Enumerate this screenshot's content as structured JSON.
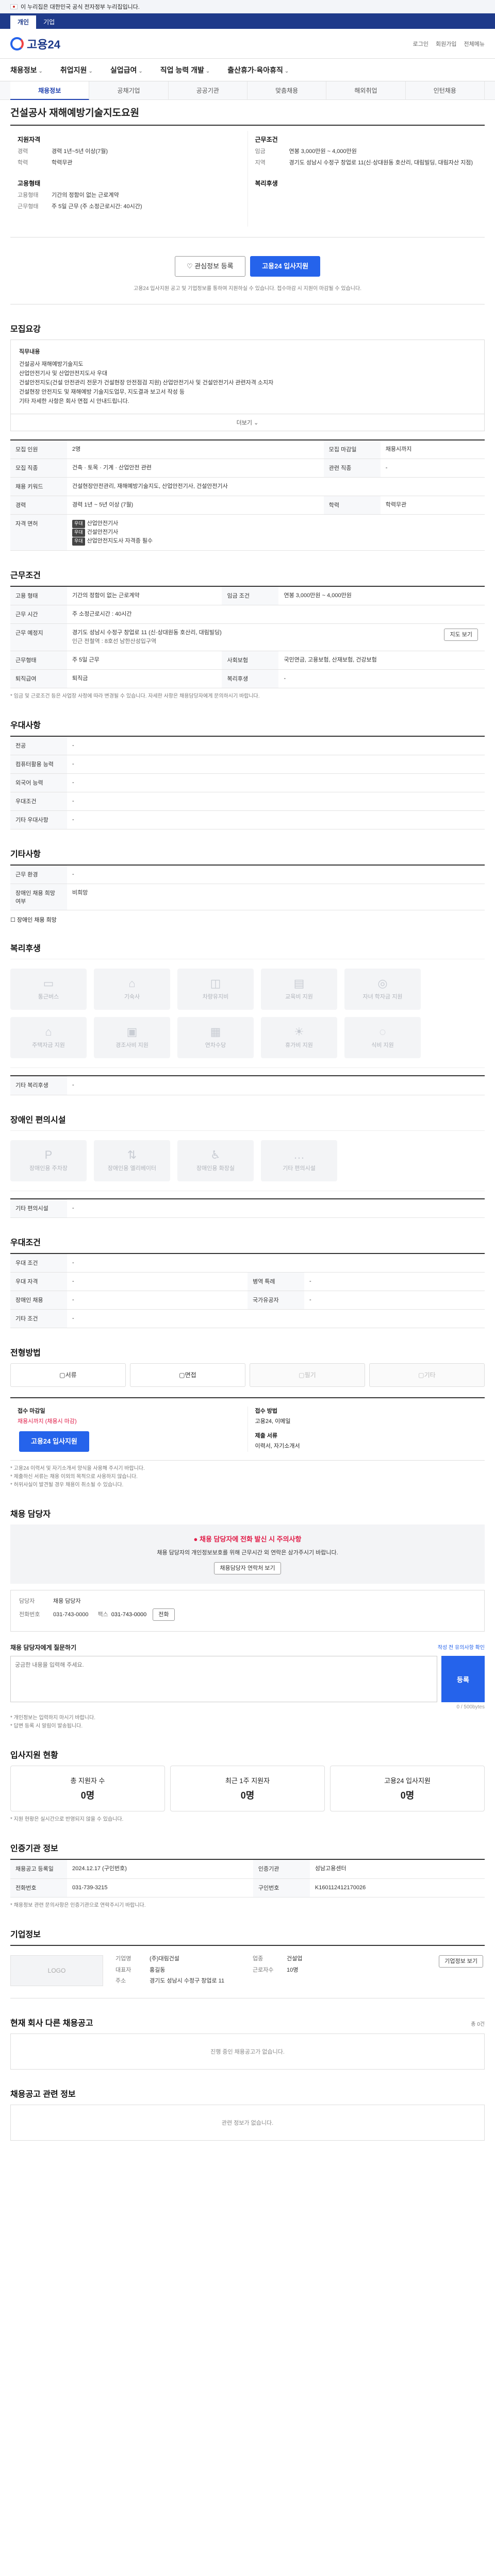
{
  "gov_banner": "이 누리집은 대한민국 공식 전자정부 누리집입니다.",
  "top_tabs": [
    "개인",
    "기업"
  ],
  "logo_text": "고용24",
  "util_links": [
    "로그인",
    "회원가입",
    "전체메뉴"
  ],
  "gnb": [
    {
      "label": "채용정보",
      "caret": "⌄"
    },
    {
      "label": "취업지원",
      "caret": "⌄"
    },
    {
      "label": "실업급여",
      "caret": "⌄"
    },
    {
      "label": "직업 능력 개발",
      "caret": "⌄"
    },
    {
      "label": "출산휴가·육아휴직",
      "caret": "⌄"
    }
  ],
  "sub_tabs": [
    "채용정보",
    "공채기업",
    "공공기관",
    "맞춤채용",
    "해외취업",
    "인턴채용"
  ],
  "page_title": "건설공사 재해예방기술지도요원",
  "summary": {
    "col1": {
      "h": "지원자격",
      "rows": [
        [
          "경력",
          "경력 1년~5년 이상(7월)"
        ],
        [
          "학력",
          "학력무관"
        ]
      ]
    },
    "col2": {
      "h": "근무조건",
      "rows": [
        [
          "임금",
          "연봉 3,000만원 ~ 4,000만원"
        ],
        [
          "지역",
          "경기도 성남시 수정구 창업로 11(신·상대원동 호산리, 대림빌딩, 대림자산 지점)"
        ]
      ]
    },
    "col3": {
      "h": "고용형태",
      "rows": [
        [
          "고용형태",
          "기간의 정함이 없는 근로계약"
        ],
        [
          "근무형태",
          "주 5일 근무 (주 소정근로시간: 40시간)"
        ]
      ]
    },
    "col4": {
      "h": "복리후생",
      "rows": []
    }
  },
  "actions": {
    "save": "관심정보 등록",
    "apply": "고용24 입사지원"
  },
  "actions_note": "고용24 입사지원 공고 및 기업정보를 통하여 지원하실 수 있습니다. 접수마감 시 지원이 마감될 수 있습니다.",
  "recruit": {
    "h": "모집요강",
    "box_title": "직무내용",
    "lines": [
      "건설공사 재해예방기술지도",
      "산업안전기사 및 산업안전지도사 우대",
      "건설안전지도(건설 안전관리 전문가 건설현장 안전점검 지원) 산업안전기사 및 건설안전기사 관련자격 소지자",
      "건설현장 안전지도 및 재해예방 기술지도업무, 지도결과 보고서 작성 등",
      "기타 자세한 사항은 회사 면접 시 안내드립니다."
    ],
    "more": "더보기",
    "table": [
      [
        "모집 인원",
        "2명",
        "모집 마감일",
        "채용시까지"
      ],
      [
        "모집 직종",
        "건축 · 토목 · 기계 · 산업안전 관련",
        "관련 직종",
        "-"
      ],
      [
        "채용 키워드",
        "건설현장안전관리, 재해예방기술지도, 산업안전기사, 건설안전기사",
        "",
        ""
      ],
      [
        "경력",
        "경력 1년 ~ 5년 이상 (7월)",
        "학력",
        "학력무관"
      ]
    ],
    "cert_label": "자격 면허",
    "certs": [
      {
        "badge": "우대",
        "text": "산업안전기사"
      },
      {
        "badge": "우대",
        "text": "건설안전기사"
      },
      {
        "badge": "우대",
        "text": "산업안전지도사 자격증 필수"
      }
    ]
  },
  "conditions": {
    "h": "근무조건",
    "rows": [
      [
        "고용 형태",
        "기간의 정함이 없는 근로계약",
        "임금 조건",
        "연봉 3,000만원 ~ 4,000만원"
      ],
      [
        "근무 시간",
        "주 소정근로시간 : 40시간",
        "",
        ""
      ],
      [
        "근무 예정지",
        "경기도 성남시 수정구 창업로 11 (신·상대원동 호산리, 대림빌딩)",
        "",
        ""
      ],
      [
        "근무형태",
        "주 5일 근무",
        "사회보험",
        "국민연금, 고용보험, 산재보험, 건강보험"
      ],
      [
        "퇴직급여",
        "퇴직금",
        "복리후생",
        "-"
      ]
    ],
    "view_map": "지도 보기",
    "subway": "인근 전철역 : 8호선 남한산성입구역",
    "footnote": "* 임금 및 근로조건 등은 사업장 사정에 따라 변경될 수 있습니다. 자세한 사항은 채용담당자에게 문의하시기 바랍니다."
  },
  "prefer": {
    "h": "우대사항",
    "rows": [
      [
        "전공",
        "-"
      ],
      [
        "컴퓨터활용 능력",
        "-"
      ],
      [
        "외국어 능력",
        "-"
      ],
      [
        "우대조건",
        "-"
      ],
      [
        "기타 우대사항",
        "-"
      ]
    ]
  },
  "prefer_other": {
    "h": "기타사항",
    "rows": [
      [
        "근무 환경",
        "-"
      ],
      [
        "장애인 채용 희망 여부",
        "비희망"
      ]
    ],
    "checkbox": "장애인 채용 희망"
  },
  "welfare": {
    "h": "복리후생",
    "items": [
      "통근버스",
      "기숙사",
      "차량유지비",
      "교육비 지원",
      "자녀 학자금 지원",
      "주택자금 지원",
      "경조사비 지원",
      "연차수당",
      "휴가비 지원",
      "식비 지원"
    ],
    "other_label": "기타 복리후생",
    "other_value": "-"
  },
  "disabled": {
    "h": "장애인 편의시설",
    "items": [
      "장애인용 주차장",
      "장애인용 엘리베이터",
      "장애인용 화장실",
      "기타 편의시설"
    ],
    "other_label": "기타 편의시설",
    "other_value": "-"
  },
  "selection": {
    "h": "우대조건",
    "rows": [
      [
        "우대 조건",
        "-",
        "",
        ""
      ],
      [
        "우대 자격",
        "-",
        "병역 특례",
        "-"
      ],
      [
        "장애인 채용",
        "-",
        "국가유공자",
        "-"
      ],
      [
        "기타 조건",
        "-",
        "",
        ""
      ]
    ]
  },
  "process": {
    "h": "전형방법",
    "steps": [
      "서류",
      "면접",
      "필기",
      "기타"
    ],
    "apply_h1": "접수 마감일",
    "apply_v1": "채용시까지 (채용시 마감)",
    "apply_h2": "접수 방법",
    "apply_v2": "고용24, 이메일",
    "apply_btn": "고용24 입사지원",
    "apply_h3": "제출 서류",
    "apply_v3": "이력서, 자기소개서",
    "notes": [
      "* 고용24 이력서 및 자기소개서 양식을 사용해 주시기 바랍니다.",
      "* 제출하신 서류는 채용 이외의 목적으로 사용하지 않습니다.",
      "* 허위사실이 발견될 경우 채용이 취소될 수 있습니다."
    ]
  },
  "contact": {
    "h": "채용 담당자",
    "alert_head": "채용 담당자에 전화 발신 시 주의사항",
    "alert_body": "채용 담당자의 개인정보보호를 위해 근무시간 외 연락은 삼가주시기 바랍니다.",
    "alert_link": "채용담당자 연락처 보기",
    "person_label": "담당자",
    "person_name": "채용 담당자",
    "tel_label": "전화번호",
    "tel": "031-743-0000",
    "fax_label": "팩스",
    "fax": "031-743-0000",
    "call_btn": "전화",
    "qa_h": "채용 담당자에게 질문하기",
    "qa_right": "작성 전 유의사항 확인",
    "qa_placeholder": "궁금한 내용을 입력해 주세요.",
    "qa_count": "0 / 500bytes",
    "qa_btn": "등록",
    "qa_notes": [
      "* 개인정보는 입력하지 마시기 바랍니다.",
      "* 답변 등록 시 알림이 발송됩니다."
    ]
  },
  "stats": {
    "h": "입사지원 현황",
    "cards": [
      {
        "label": "총 지원자 수",
        "value": "0명"
      },
      {
        "label": "최근 1주 지원자",
        "value": "0명"
      },
      {
        "label": "고용24 입사지원",
        "value": "0명"
      }
    ],
    "note": "* 지원 현황은 실시간으로 반영되지 않을 수 있습니다."
  },
  "register": {
    "h": "인증기관 정보",
    "rows": [
      [
        "채용공고 등록일",
        "2024.12.17 (구인번호)",
        "인증기관",
        "성남고용센터"
      ],
      [
        "전화번호",
        "031-739-3215",
        "구인번호",
        "K160112412170026"
      ]
    ],
    "footnote": "* 채용정보 관련 문의사항은 인증기관으로 연락주시기 바랍니다."
  },
  "company": {
    "h": "기업정보",
    "logo_alt": "LOGO",
    "rows": [
      [
        "기업명",
        "(주)대림건설",
        "업종",
        "건설업"
      ],
      [
        "대표자",
        "홍길동",
        "근로자수",
        "10명"
      ],
      [
        "주소",
        "경기도 성남시 수정구 창업로 11",
        "",
        ""
      ]
    ],
    "btn": "기업정보 보기"
  },
  "same_company": {
    "h": "현재 회사 다른 채용공고",
    "right": "총 0건",
    "empty": "진행 중인 채용공고가 없습니다."
  },
  "related": {
    "h": "채용공고 관련 정보",
    "empty": "관련 정보가 없습니다."
  }
}
